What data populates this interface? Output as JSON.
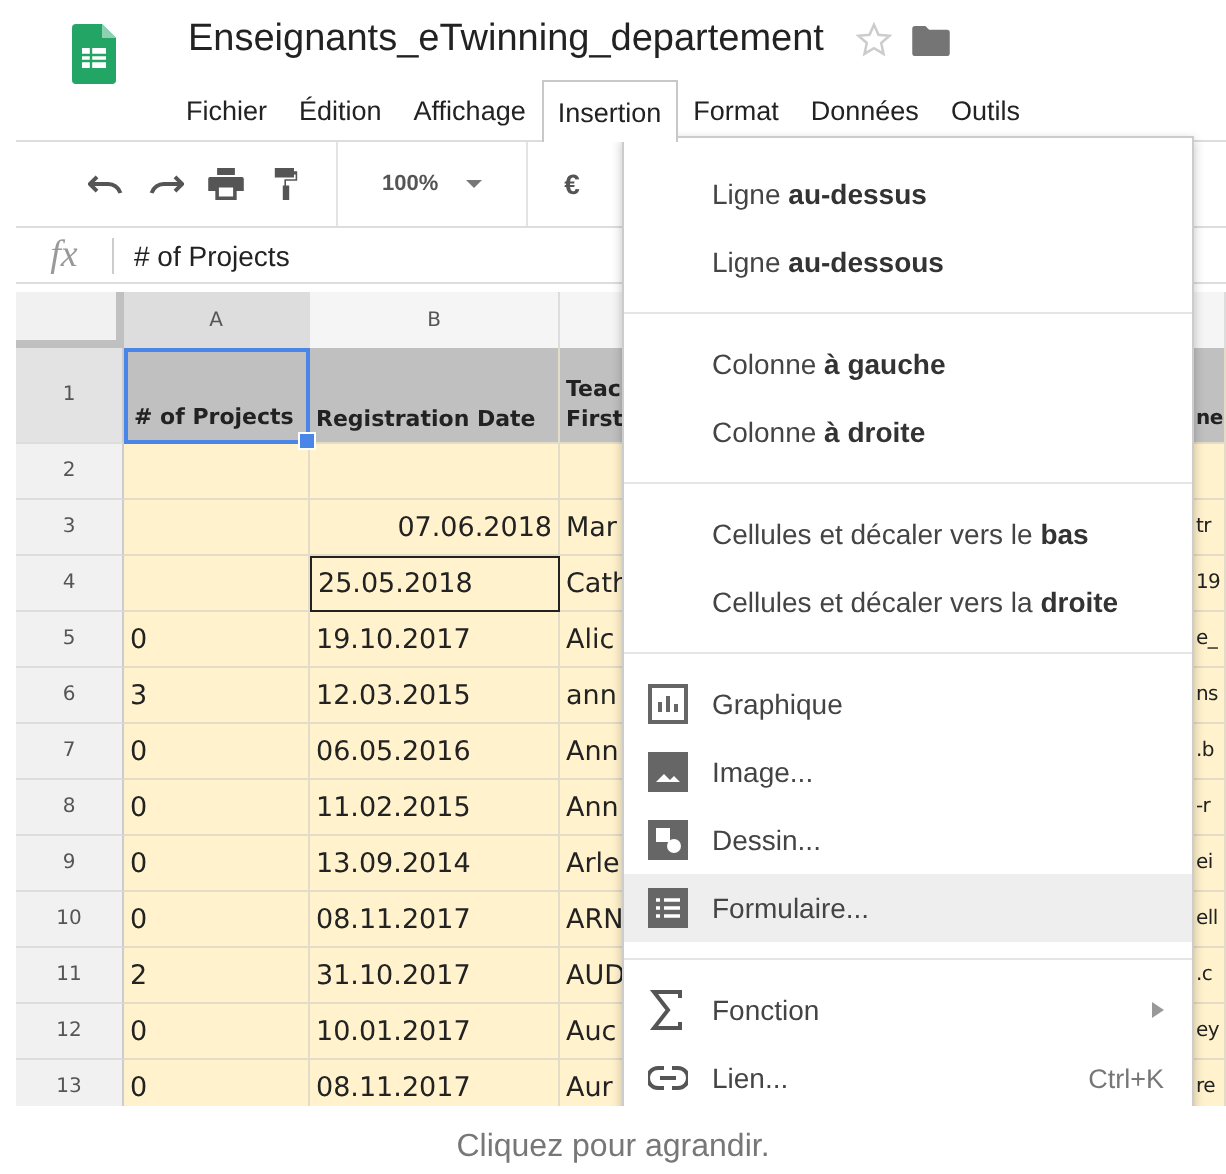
{
  "document": {
    "title": "Enseignants_eTwinning_departement"
  },
  "menubar": [
    {
      "label": "Fichier",
      "selected": false
    },
    {
      "label": "Édition",
      "selected": false
    },
    {
      "label": "Affichage",
      "selected": false
    },
    {
      "label": "Insertion",
      "selected": true
    },
    {
      "label": "Format",
      "selected": false
    },
    {
      "label": "Données",
      "selected": false
    },
    {
      "label": "Outils",
      "selected": false
    }
  ],
  "toolbar": {
    "zoom": "100%",
    "currency": "€"
  },
  "formula_bar": {
    "label": "fx",
    "value": "# of Projects"
  },
  "columns": [
    {
      "label": "A",
      "selected": true
    },
    {
      "label": "B",
      "selected": false
    }
  ],
  "rows": [
    {
      "number": "1",
      "kind": "header",
      "cells": [
        "# of Projects",
        "Registration Date",
        "Teac First",
        "ne"
      ],
      "date_right": false,
      "outlined": false
    },
    {
      "number": "2",
      "kind": "data",
      "cells": [
        "",
        "",
        "",
        ""
      ],
      "date_right": false,
      "outlined": false
    },
    {
      "number": "3",
      "kind": "data",
      "cells": [
        "",
        "07.06.2018",
        "Mar",
        "tr"
      ],
      "date_right": true,
      "outlined": false
    },
    {
      "number": "4",
      "kind": "data",
      "cells": [
        "",
        "25.05.2018",
        "Cath",
        "19"
      ],
      "date_right": false,
      "outlined": true
    },
    {
      "number": "5",
      "kind": "data",
      "cells": [
        "0",
        "19.10.2017",
        "Alic",
        "e_"
      ],
      "date_right": false,
      "outlined": false
    },
    {
      "number": "6",
      "kind": "data",
      "cells": [
        "3",
        "12.03.2015",
        "ann",
        "ns"
      ],
      "date_right": false,
      "outlined": false
    },
    {
      "number": "7",
      "kind": "data",
      "cells": [
        "0",
        "06.05.2016",
        "Ann",
        ".b"
      ],
      "date_right": false,
      "outlined": false
    },
    {
      "number": "8",
      "kind": "data",
      "cells": [
        "0",
        "11.02.2015",
        "Ann",
        "-r"
      ],
      "date_right": false,
      "outlined": false
    },
    {
      "number": "9",
      "kind": "data",
      "cells": [
        "0",
        "13.09.2014",
        "Arle",
        "ei"
      ],
      "date_right": false,
      "outlined": false
    },
    {
      "number": "10",
      "kind": "data",
      "cells": [
        "0",
        "08.11.2017",
        "ARN",
        "ell"
      ],
      "date_right": false,
      "outlined": false
    },
    {
      "number": "11",
      "kind": "data",
      "cells": [
        "2",
        "31.10.2017",
        "AUD",
        ".c"
      ],
      "date_right": false,
      "outlined": false
    },
    {
      "number": "12",
      "kind": "data",
      "cells": [
        "0",
        "10.01.2017",
        "Auc",
        "ey"
      ],
      "date_right": false,
      "outlined": false
    },
    {
      "number": "13",
      "kind": "data",
      "cells": [
        "0",
        "08.11.2017",
        "Aur",
        "re"
      ],
      "date_right": false,
      "outlined": false
    }
  ],
  "insert_menu": [
    [
      {
        "kind": "plain",
        "label": "Ligne **au-dessus**",
        "selected": false,
        "submenu": false
      },
      {
        "kind": "plain",
        "label": "Ligne **au-dessous**",
        "selected": false,
        "submenu": false
      }
    ],
    [
      {
        "kind": "plain",
        "label": "Colonne **à gauche**",
        "selected": false,
        "submenu": false
      },
      {
        "kind": "plain",
        "label": "Colonne **à droite**",
        "selected": false,
        "submenu": false
      }
    ],
    [
      {
        "kind": "plain",
        "label": "Cellules et décaler vers le **bas**",
        "selected": false,
        "submenu": false
      },
      {
        "kind": "plain",
        "label": "Cellules et décaler vers la **droite**",
        "selected": false,
        "submenu": false
      }
    ],
    [
      {
        "kind": "chart",
        "label": "Graphique",
        "selected": false,
        "submenu": false
      },
      {
        "kind": "image",
        "label": "Image...",
        "selected": false,
        "submenu": false
      },
      {
        "kind": "drawing",
        "label": "Dessin...",
        "selected": false,
        "submenu": false
      },
      {
        "kind": "form",
        "label": "Formulaire...",
        "selected": true,
        "submenu": false
      }
    ],
    [
      {
        "kind": "function",
        "label": "Fonction",
        "selected": false,
        "submenu": true
      },
      {
        "kind": "link",
        "label": "Lien...",
        "shortcut": "Ctrl+K",
        "selected": false,
        "submenu": false
      }
    ]
  ],
  "caption": "Cliquez pour agrandir."
}
